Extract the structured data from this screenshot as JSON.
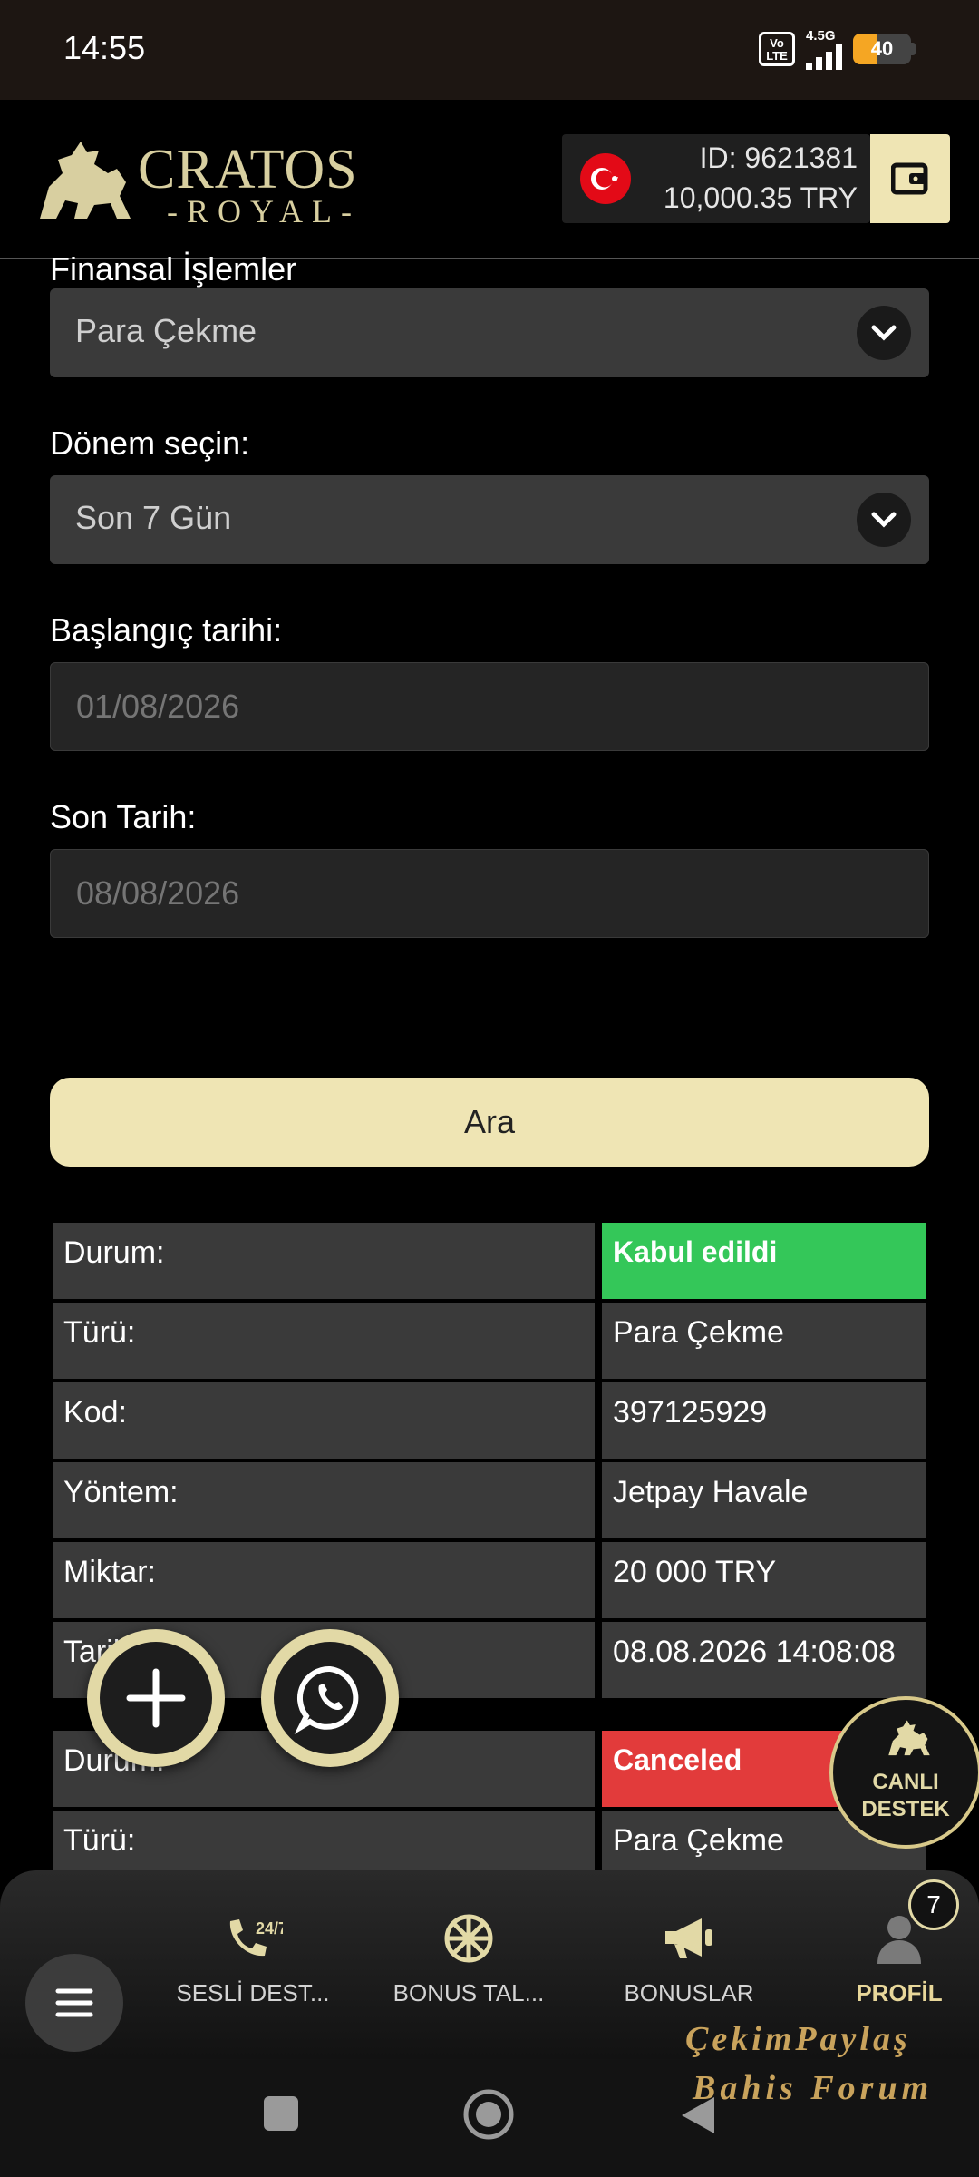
{
  "status_bar": {
    "time": "14:55",
    "volte": "Vo LTE",
    "network": "4.5G",
    "battery": "40",
    "battery_level": 0.4
  },
  "header": {
    "logo_title": "CRATOS",
    "logo_subtitle": "-ROYAL-",
    "account_id": "ID: 9621381",
    "balance": "10,000.35   TRY",
    "wallet_icon": "wallet-icon"
  },
  "form": {
    "section_label": "Finansal İşlemler",
    "transaction_type": "Para Çekme",
    "period_label": "Dönem seçin:",
    "period_value": "Son 7 Gün",
    "start_label": "Başlangıç tarihi:",
    "start_placeholder": "01/08/2026",
    "end_label": "Son Tarih:",
    "end_placeholder": "08/08/2026",
    "search_label": "Ara"
  },
  "transactions": [
    {
      "rows": [
        {
          "key": "Durum:",
          "value": "Kabul edildi",
          "status": "ok"
        },
        {
          "key": "Türü:",
          "value": "Para Çekme"
        },
        {
          "key": "Kod:",
          "value": "397125929"
        },
        {
          "key": "Yöntem:",
          "value": "Jetpay Havale"
        },
        {
          "key": "Miktar:",
          "value": "20 000 TRY"
        },
        {
          "key": "Tarih:",
          "value": "08.08.2026 14:08:08"
        }
      ]
    },
    {
      "rows": [
        {
          "key": "Durum:",
          "value": "Canceled",
          "status": "cancel"
        },
        {
          "key": "Türü:",
          "value": "Para Çekme"
        }
      ]
    }
  ],
  "support_badge": {
    "line1": "CANLI",
    "line2": "DESTEK"
  },
  "bottom_nav": {
    "items": [
      {
        "label": "SESLİ DEST...",
        "icon": "phone-24-7-icon"
      },
      {
        "label": "BONUS TAL...",
        "icon": "wheel-icon"
      },
      {
        "label": "BONUSLAR",
        "icon": "megaphone-icon"
      },
      {
        "label": "PROFİL",
        "icon": "user-icon"
      }
    ],
    "notification_count": "7"
  },
  "watermark": {
    "line1": "ÇekimPaylaş",
    "line2": "Bahis Forum"
  },
  "colors": {
    "accent": "#efe5b4",
    "success": "#34c759",
    "danger": "#e23b3b",
    "field": "#3a3a3a"
  }
}
